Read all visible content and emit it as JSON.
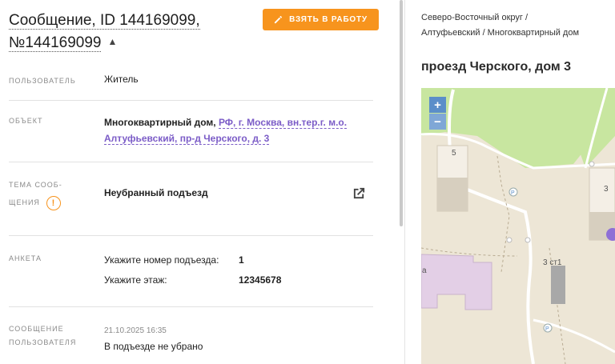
{
  "message": {
    "title_prefix": "Сообщение, ID 144169099,",
    "title_number": "№144169099",
    "take_button": "ВЗЯТЬ В РАБОТУ"
  },
  "fields": {
    "user_label": "ПОЛЬЗОВАТЕЛЬ",
    "user_value": "Житель",
    "object_label": "ОБЪЕКТ",
    "object_type": "Многоквартирный дом,",
    "object_link": "РФ, г. Москва, вн.тер.г. м.о. Алтуфьевский, пр-д Черского, д. 3",
    "topic_label_1": "ТЕМА СООБ-",
    "topic_label_2": "ЩЕНИЯ",
    "topic_value": "Неубранный подъезд",
    "survey_label": "АНКЕТА",
    "survey": [
      {
        "question": "Укажите номер подъезда:",
        "answer": "1"
      },
      {
        "question": "Укажите этаж:",
        "answer": "12345678"
      }
    ],
    "msg_label_1": "СООБЩЕНИЕ",
    "msg_label_2": "ПОЛЬЗОВАТЕЛЯ",
    "msg_date": "21.10.2025 16:35",
    "msg_text": "В подъезде не убрано"
  },
  "sidebar": {
    "breadcrumb_1": "Северо-Восточный округ /",
    "breadcrumb_2": "Алтуфьевский / Многоквартирный дом",
    "address": "проезд Черского, дом 3"
  },
  "map": {
    "zoom_in": "+",
    "zoom_out": "−",
    "building_5": "5",
    "building_3": "3",
    "building_3s1": "3 ст1",
    "parking_label": "P",
    "partial_label": "а"
  },
  "colors": {
    "accent": "#f7941d",
    "link": "#7b5cc7",
    "map_bg": "#ede6d6",
    "park": "#c8e6a0",
    "highlight_building": "#e3cfe6",
    "marker": "#8e6fd6"
  },
  "icons": {
    "pencil": "pencil-icon",
    "chevron": "chevron-up-icon",
    "warning": "warning-icon",
    "external": "external-link-icon"
  }
}
